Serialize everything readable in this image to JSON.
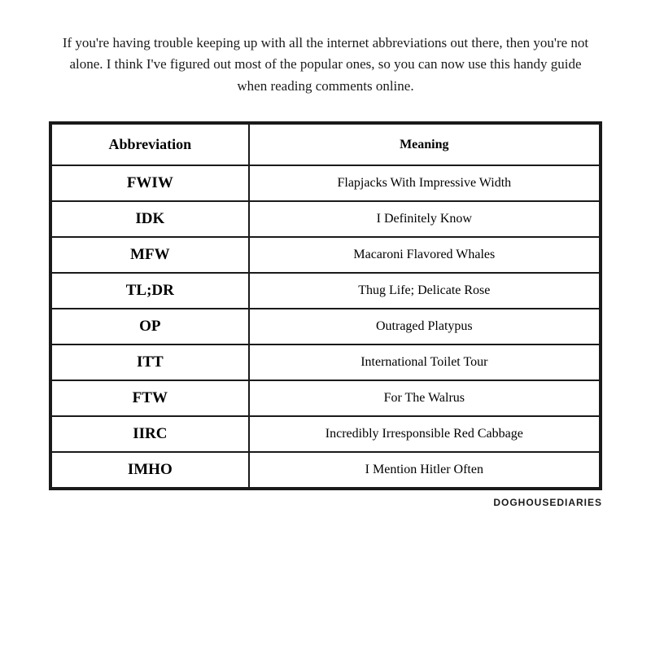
{
  "intro": {
    "text": "If you're having trouble keeping up with all the internet abbreviations out there, then you're not alone.  I think I've figured out most of the popular ones, so you can now use this handy guide when reading comments online."
  },
  "table": {
    "headers": {
      "abbreviation": "Abbreviation",
      "meaning": "Meaning"
    },
    "rows": [
      {
        "abbr": "FWIW",
        "meaning": "Flapjacks With Impressive Width"
      },
      {
        "abbr": "IDK",
        "meaning": "I Definitely Know"
      },
      {
        "abbr": "MFW",
        "meaning": "Macaroni Flavored Whales"
      },
      {
        "abbr": "TL;DR",
        "meaning": "Thug Life; Delicate Rose"
      },
      {
        "abbr": "OP",
        "meaning": "Outraged Platypus"
      },
      {
        "abbr": "ITT",
        "meaning": "International Toilet Tour"
      },
      {
        "abbr": "FTW",
        "meaning": "For The Walrus"
      },
      {
        "abbr": "IIRC",
        "meaning": "Incredibly Irresponsible Red Cabbage"
      },
      {
        "abbr": "IMHO",
        "meaning": "I Mention Hitler Often"
      }
    ]
  },
  "footer": {
    "text": "DOGHOUSEDIARIES"
  }
}
